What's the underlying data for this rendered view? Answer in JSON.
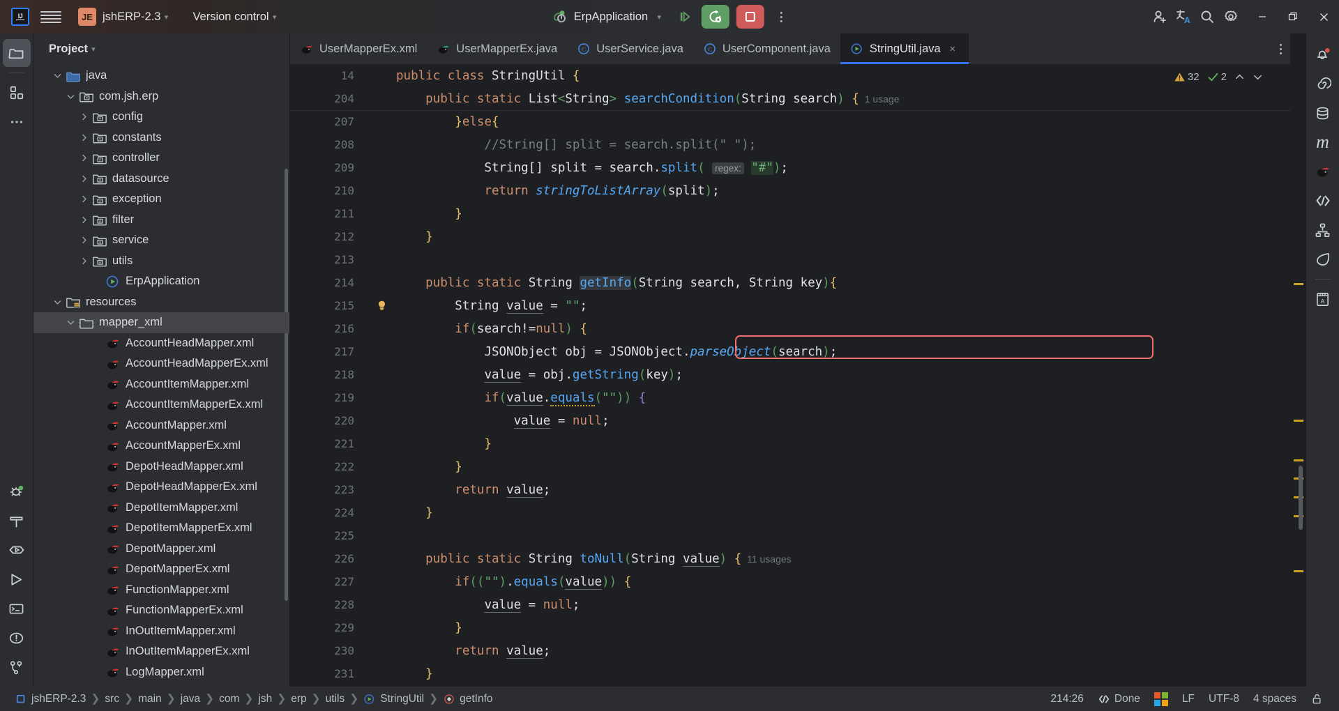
{
  "titlebar": {
    "logo_icon": "intellij-idea-logo",
    "menu_icon": "hamburger-menu-icon",
    "project_badge": "JE",
    "project_name": "jshERP-2.3",
    "vcs_label": "Version control",
    "run_config": "ErpApplication",
    "run_config_icon": "spring-boot-run-icon",
    "debug_icon": "debug-step-icon",
    "rerun_icon": "rerun-gear-icon",
    "stop_icon": "stop-square-icon",
    "more_icon": "more-vertical-icon",
    "account_icon": "account-add-icon",
    "translate_icon": "translate-icon",
    "search_icon": "search-icon",
    "settings_icon": "gear-icon",
    "minimize_icon": "minimize-icon",
    "maximize_icon": "restore-window-icon",
    "close_icon": "close-icon"
  },
  "left_stripe": {
    "items": [
      {
        "name": "project-tool-window",
        "icon": "folder-icon",
        "active": true
      },
      {
        "name": "commit-tool-window",
        "icon": "structure-blocks-icon",
        "active": false
      },
      {
        "name": "more-tool-windows",
        "icon": "ellipsis-icon",
        "active": false
      }
    ],
    "bottom_items": [
      {
        "name": "debug-tool-window",
        "icon": "bug-icon"
      },
      {
        "name": "build-tool-window",
        "icon": "hammer-icon"
      },
      {
        "name": "services-tool-window",
        "icon": "services-play-icon"
      },
      {
        "name": "run-tool-window",
        "icon": "play-triangle-icon"
      },
      {
        "name": "terminal-tool-window",
        "icon": "terminal-icon"
      },
      {
        "name": "problems-tool-window",
        "icon": "warning-circle-icon"
      },
      {
        "name": "git-tool-window",
        "icon": "git-branch-icon"
      }
    ]
  },
  "project_panel": {
    "title": "Project",
    "title_chevron": "chevron-down-icon",
    "tree": [
      {
        "label": "java",
        "indent": 5,
        "arrow": "down",
        "icon": "source-folder-icon",
        "selected": false
      },
      {
        "label": "com.jsh.erp",
        "indent": 6,
        "arrow": "down",
        "icon": "package-icon",
        "selected": false
      },
      {
        "label": "config",
        "indent": 7,
        "arrow": "right",
        "icon": "package-icon",
        "selected": false
      },
      {
        "label": "constants",
        "indent": 7,
        "arrow": "right",
        "icon": "package-icon",
        "selected": false
      },
      {
        "label": "controller",
        "indent": 7,
        "arrow": "right",
        "icon": "package-icon",
        "selected": false
      },
      {
        "label": "datasource",
        "indent": 7,
        "arrow": "right",
        "icon": "package-icon",
        "selected": false
      },
      {
        "label": "exception",
        "indent": 7,
        "arrow": "right",
        "icon": "package-icon",
        "selected": false
      },
      {
        "label": "filter",
        "indent": 7,
        "arrow": "right",
        "icon": "package-icon",
        "selected": false
      },
      {
        "label": "service",
        "indent": 7,
        "arrow": "right",
        "icon": "package-icon",
        "selected": false
      },
      {
        "label": "utils",
        "indent": 7,
        "arrow": "right",
        "icon": "package-icon",
        "selected": false
      },
      {
        "label": "ErpApplication",
        "indent": 8,
        "arrow": "none",
        "icon": "spring-class-icon",
        "selected": false
      },
      {
        "label": "resources",
        "indent": 5,
        "arrow": "down",
        "icon": "resources-folder-icon",
        "selected": false
      },
      {
        "label": "mapper_xml",
        "indent": 6,
        "arrow": "down",
        "icon": "folder-plain-icon",
        "selected": true
      },
      {
        "label": "AccountHeadMapper.xml",
        "indent": 8,
        "arrow": "none",
        "icon": "mybatis-icon",
        "selected": false
      },
      {
        "label": "AccountHeadMapperEx.xml",
        "indent": 8,
        "arrow": "none",
        "icon": "mybatis-icon",
        "selected": false
      },
      {
        "label": "AccountItemMapper.xml",
        "indent": 8,
        "arrow": "none",
        "icon": "mybatis-icon",
        "selected": false
      },
      {
        "label": "AccountItemMapperEx.xml",
        "indent": 8,
        "arrow": "none",
        "icon": "mybatis-icon",
        "selected": false
      },
      {
        "label": "AccountMapper.xml",
        "indent": 8,
        "arrow": "none",
        "icon": "mybatis-icon",
        "selected": false
      },
      {
        "label": "AccountMapperEx.xml",
        "indent": 8,
        "arrow": "none",
        "icon": "mybatis-icon",
        "selected": false
      },
      {
        "label": "DepotHeadMapper.xml",
        "indent": 8,
        "arrow": "none",
        "icon": "mybatis-icon",
        "selected": false
      },
      {
        "label": "DepotHeadMapperEx.xml",
        "indent": 8,
        "arrow": "none",
        "icon": "mybatis-icon",
        "selected": false
      },
      {
        "label": "DepotItemMapper.xml",
        "indent": 8,
        "arrow": "none",
        "icon": "mybatis-icon",
        "selected": false
      },
      {
        "label": "DepotItemMapperEx.xml",
        "indent": 8,
        "arrow": "none",
        "icon": "mybatis-icon",
        "selected": false
      },
      {
        "label": "DepotMapper.xml",
        "indent": 8,
        "arrow": "none",
        "icon": "mybatis-icon",
        "selected": false
      },
      {
        "label": "DepotMapperEx.xml",
        "indent": 8,
        "arrow": "none",
        "icon": "mybatis-icon",
        "selected": false
      },
      {
        "label": "FunctionMapper.xml",
        "indent": 8,
        "arrow": "none",
        "icon": "mybatis-icon",
        "selected": false
      },
      {
        "label": "FunctionMapperEx.xml",
        "indent": 8,
        "arrow": "none",
        "icon": "mybatis-icon",
        "selected": false
      },
      {
        "label": "InOutItemMapper.xml",
        "indent": 8,
        "arrow": "none",
        "icon": "mybatis-icon",
        "selected": false
      },
      {
        "label": "InOutItemMapperEx.xml",
        "indent": 8,
        "arrow": "none",
        "icon": "mybatis-icon",
        "selected": false
      },
      {
        "label": "LogMapper.xml",
        "indent": 8,
        "arrow": "none",
        "icon": "mybatis-icon",
        "selected": false
      }
    ]
  },
  "editor": {
    "tabs": [
      {
        "label": "UserMapperEx.xml",
        "icon": "mybatis-icon",
        "active": false,
        "closable": false
      },
      {
        "label": "UserMapperEx.java",
        "icon": "mybatis-java-icon",
        "active": false,
        "closable": false
      },
      {
        "label": "UserService.java",
        "icon": "java-class-icon",
        "active": false,
        "closable": false
      },
      {
        "label": "UserComponent.java",
        "icon": "java-class-icon",
        "active": false,
        "closable": false
      },
      {
        "label": "StringUtil.java",
        "icon": "spring-class-icon",
        "active": true,
        "closable": true
      }
    ],
    "tab_options_icon": "more-vertical-icon",
    "inspection_widget": {
      "warning_icon": "warning-triangle-icon",
      "warning_count": "32",
      "ok_icon": "checkmark-icon",
      "ok_count": "2",
      "prev_icon": "chevron-up-icon",
      "next_icon": "chevron-down-icon"
    },
    "sticky_lines": [
      {
        "num": "14",
        "text": "public class StringUtil {"
      },
      {
        "num": "204",
        "text": "public static List<String> searchCondition(String search) {",
        "usages": "1 usage"
      }
    ],
    "lines": [
      {
        "num": "207",
        "text": "}else{"
      },
      {
        "num": "208",
        "text": "//String[] split = search.split(\" \");"
      },
      {
        "num": "209",
        "text": "String[] split = search.split( regex: \"#\");"
      },
      {
        "num": "210",
        "text": "return stringToListArray(split);"
      },
      {
        "num": "211",
        "text": "}"
      },
      {
        "num": "212",
        "text": "}"
      },
      {
        "num": "213",
        "text": ""
      },
      {
        "num": "214",
        "text": "public static String getInfo(String search, String key){"
      },
      {
        "num": "215",
        "text": "String value = \"\";",
        "gutter": "intention-bulb-icon"
      },
      {
        "num": "216",
        "text": "if(search!=null) {"
      },
      {
        "num": "217",
        "text": "JSONObject obj = JSONObject.parseObject(search);",
        "highlighted": true
      },
      {
        "num": "218",
        "text": "value = obj.getString(key);"
      },
      {
        "num": "219",
        "text": "if(value.equals(\"\")) {"
      },
      {
        "num": "220",
        "text": "value = null;"
      },
      {
        "num": "221",
        "text": "}"
      },
      {
        "num": "222",
        "text": "}"
      },
      {
        "num": "223",
        "text": "return value;"
      },
      {
        "num": "224",
        "text": "}"
      },
      {
        "num": "225",
        "text": ""
      },
      {
        "num": "226",
        "text": "public static String toNull(String value) {",
        "usages": "11 usages"
      },
      {
        "num": "227",
        "text": "if((\"\").equals(value)) {"
      },
      {
        "num": "228",
        "text": "value = null;"
      },
      {
        "num": "229",
        "text": "}"
      },
      {
        "num": "230",
        "text": "return value;"
      },
      {
        "num": "231",
        "text": "}"
      }
    ],
    "highlight_color": "#f26d6d"
  },
  "right_stripe": {
    "items": [
      {
        "name": "notifications-tool-window",
        "icon": "bell-icon",
        "badge": true
      },
      {
        "name": "spring-tool-window",
        "icon": "spring-spiral-icon"
      },
      {
        "name": "database-tool-window",
        "icon": "database-icon"
      },
      {
        "name": "maven-tool-window",
        "icon": "maven-m-icon"
      },
      {
        "name": "mybatisx-tool-window",
        "icon": "mybatis-icon"
      },
      {
        "name": "codegeex-tool-window",
        "icon": "code-vision-icon"
      },
      {
        "name": "structure-tool-window",
        "icon": "hierarchy-icon"
      },
      {
        "name": "spring-boot-tool-window",
        "icon": "leaf-icon"
      },
      {
        "name": "translation-tool-window",
        "icon": "dictionary-icon"
      }
    ]
  },
  "statusbar": {
    "breadcrumbs": [
      {
        "label": "jshERP-2.3",
        "icon": "module-icon"
      },
      {
        "label": "src",
        "icon": null
      },
      {
        "label": "main",
        "icon": null
      },
      {
        "label": "java",
        "icon": null
      },
      {
        "label": "com",
        "icon": null
      },
      {
        "label": "jsh",
        "icon": null
      },
      {
        "label": "erp",
        "icon": null
      },
      {
        "label": "utils",
        "icon": null
      },
      {
        "label": "StringUtil",
        "icon": "spring-class-icon"
      },
      {
        "label": "getInfo",
        "icon": "method-icon"
      }
    ],
    "caret_position": "214:26",
    "code_vision_icon": "code-vision-icon",
    "code_vision_label": "Done",
    "os_icon": "windows-logo-icon",
    "line_separator": "LF",
    "encoding": "UTF-8",
    "indent": "4 spaces",
    "lock_icon": "unlocked-padlock-icon"
  }
}
